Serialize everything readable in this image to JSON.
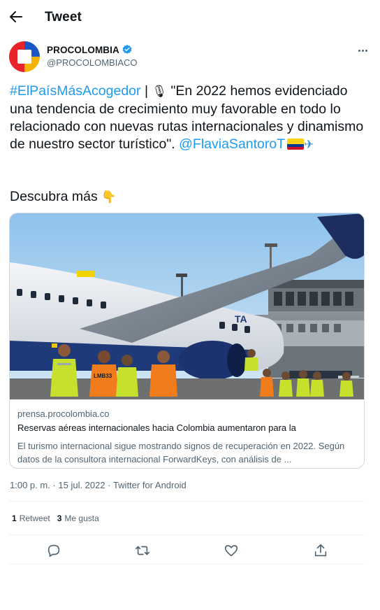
{
  "header": {
    "title": "Tweet"
  },
  "author": {
    "name": "PROCOLOMBIA",
    "handle": "@PROCOLOMBIACO"
  },
  "tweet": {
    "hashtag": "#ElPaísMásAcogedor",
    "separator": " | ",
    "mic_emoji": "🎙",
    "body": " \"En 2022 hemos evidenciado una tendencia de crecimiento muy favorable en todo lo relacionado con  nuevas rutas internacionales y dinamismo de nuestro sector turístico\". ",
    "mention": "@FlaviaSantoroT",
    "plane_emoji": "✈",
    "cta": "Descubra más",
    "cta_emoji": "👇"
  },
  "card": {
    "domain": "prensa.procolombia.co",
    "title": "Reservas aéreas internacionales hacia Colombia aumentaron para la",
    "description": "El turismo internacional sigue mostrando signos de recuperación en 2022. Según datos de la consultora internacional ForwardKeys, con análisis de ...",
    "image_text": {
      "tail_text": "TA",
      "vest_text": "LMB33"
    }
  },
  "meta": {
    "time": "1:00 p. m.",
    "dot1": " · ",
    "date": "15 jul. 2022",
    "dot2": " · ",
    "source": "Twitter for Android"
  },
  "stats": {
    "retweets_count": "1",
    "retweets_label": "Retweet",
    "likes_count": "3",
    "likes_label": "Me gusta"
  },
  "colors": {
    "link": "#1d9bf0",
    "text": "#0f1419",
    "secondary": "#536471",
    "border": "#cfd9de",
    "divider": "#eff3f4",
    "verified": "#1d9bf0"
  },
  "icons": {
    "back": "arrow-left-icon",
    "more": "more-horizontal-icon",
    "verified": "verified-badge-icon",
    "reply": "reply-icon",
    "retweet": "retweet-icon",
    "like": "heart-icon",
    "share": "share-icon"
  }
}
